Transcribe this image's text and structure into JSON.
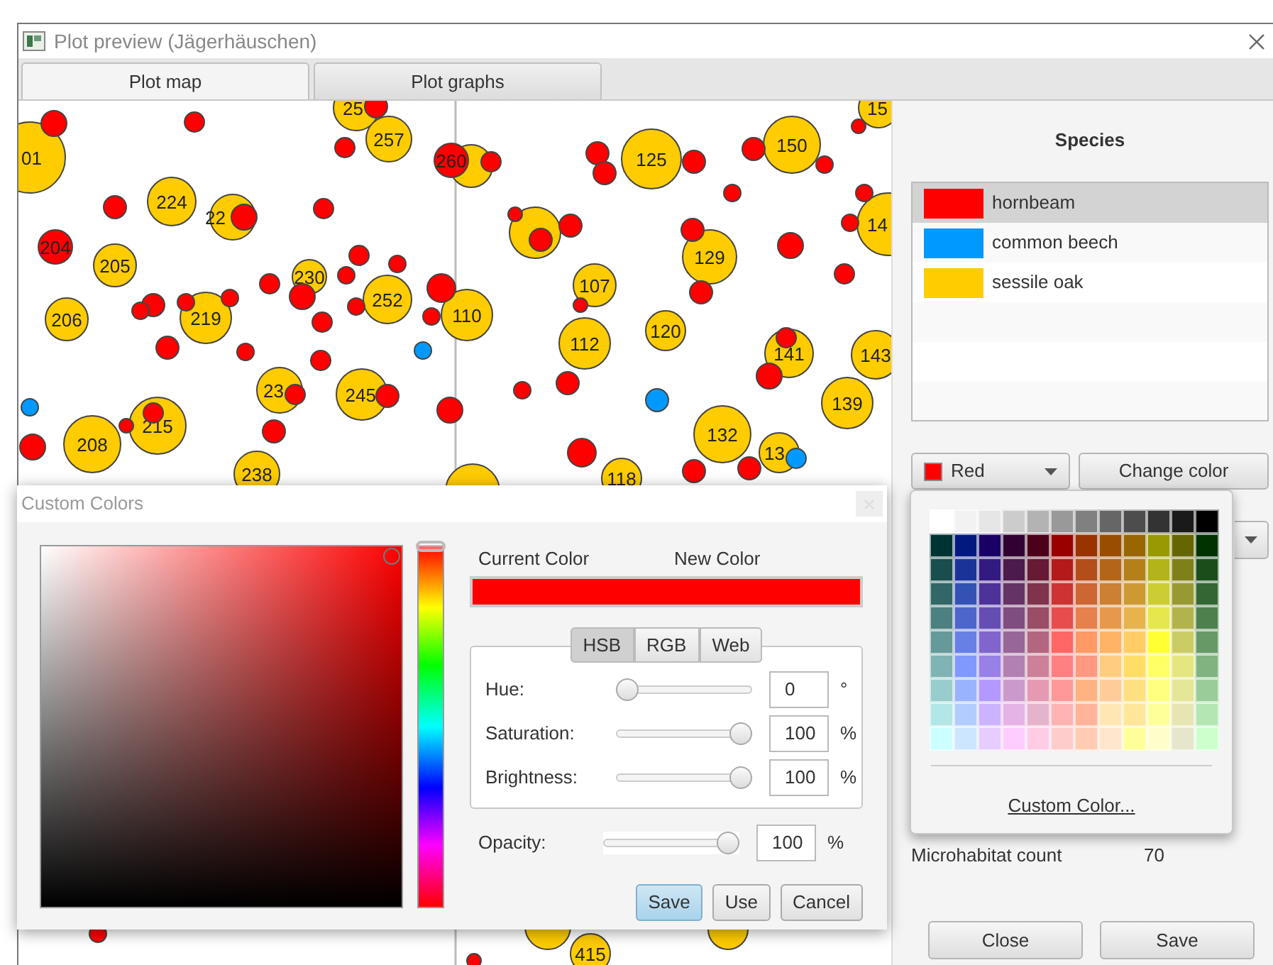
{
  "window": {
    "title": "Plot preview (Jägerhäuschen)"
  },
  "tabs": [
    {
      "label": "Plot map",
      "selected": true
    },
    {
      "label": "Plot graphs",
      "selected": false
    }
  ],
  "map": {
    "trees": [
      {
        "color": "#ffcc00",
        "label": "01"
      },
      {
        "color": "#ffcc00",
        "label": "25"
      },
      {
        "color": "#ffcc00",
        "label": "257"
      },
      {
        "color": "#ffcc00",
        "label": "224"
      },
      {
        "color": "#ffcc00",
        "label": "22"
      },
      {
        "color": "#ffcc00",
        "label": "205"
      },
      {
        "color": "#ffcc00",
        "label": "206"
      },
      {
        "color": "#ffcc00",
        "label": "219"
      },
      {
        "color": "#ffcc00",
        "label": "230"
      },
      {
        "color": "#ffcc00",
        "label": "252"
      },
      {
        "color": "#ffcc00",
        "label": "110"
      },
      {
        "color": "#ffcc00",
        "label": "23"
      },
      {
        "color": "#ffcc00",
        "label": "245"
      },
      {
        "color": "#ffcc00",
        "label": "215"
      },
      {
        "color": "#ffcc00",
        "label": "208"
      },
      {
        "color": "#ffcc00",
        "label": "238"
      },
      {
        "color": "#ffcc00"
      },
      {
        "color": "#ffcc00",
        "label": "125"
      },
      {
        "color": "#ffcc00",
        "label": "150"
      },
      {
        "color": "#ffcc00",
        "label": "15"
      },
      {
        "color": "#ffcc00",
        "label": "14"
      },
      {
        "color": "#ffcc00"
      },
      {
        "color": "#ffcc00",
        "label": "129"
      },
      {
        "color": "#ffcc00",
        "label": "107"
      },
      {
        "color": "#ffcc00",
        "label": "112"
      },
      {
        "color": "#ffcc00",
        "label": "120"
      },
      {
        "color": "#ffcc00",
        "label": "141"
      },
      {
        "color": "#ffcc00",
        "label": "143"
      },
      {
        "color": "#ffcc00",
        "label": "139"
      },
      {
        "color": "#ffcc00",
        "label": "132"
      },
      {
        "color": "#ffcc00",
        "label": "13"
      },
      {
        "color": "#ffcc00",
        "label": "118"
      },
      {
        "color": "#ffcc00"
      },
      {
        "color": "#ffcc00",
        "label": "415"
      },
      {
        "color": "#ffcc00"
      },
      {
        "color": "#ffcc00"
      },
      {
        "color": "#ff0000",
        "label": "260"
      },
      {
        "color": "#ff0000",
        "label": "204"
      },
      {
        "color": "#ff0000"
      },
      {
        "color": "#ff0000"
      },
      {
        "color": "#ff0000"
      },
      {
        "color": "#ff0000"
      },
      {
        "color": "#ff0000"
      },
      {
        "color": "#ff0000"
      },
      {
        "color": "#ff0000"
      },
      {
        "color": "#ff0000"
      },
      {
        "color": "#ff0000"
      },
      {
        "color": "#ff0000"
      },
      {
        "color": "#ff0000"
      },
      {
        "color": "#ff0000"
      },
      {
        "color": "#ff0000"
      },
      {
        "color": "#ff0000"
      },
      {
        "color": "#ff0000"
      },
      {
        "color": "#ff0000"
      },
      {
        "color": "#ff0000"
      },
      {
        "color": "#ff0000"
      },
      {
        "color": "#ff0000"
      },
      {
        "color": "#ff0000"
      },
      {
        "color": "#ff0000"
      },
      {
        "color": "#ff0000"
      },
      {
        "color": "#ff0000"
      },
      {
        "color": "#ff0000"
      },
      {
        "color": "#ff0000"
      },
      {
        "color": "#ff0000"
      },
      {
        "color": "#ff0000"
      },
      {
        "color": "#ff0000"
      },
      {
        "color": "#ff0000"
      },
      {
        "color": "#ff0000"
      },
      {
        "color": "#ff0000"
      },
      {
        "color": "#ff0000"
      },
      {
        "color": "#ff0000"
      },
      {
        "color": "#ff0000"
      },
      {
        "color": "#ff0000"
      },
      {
        "color": "#ff0000"
      },
      {
        "color": "#ff0000"
      },
      {
        "color": "#ff0000"
      },
      {
        "color": "#ff0000"
      },
      {
        "color": "#ff0000"
      },
      {
        "color": "#ff0000"
      },
      {
        "color": "#ff0000"
      },
      {
        "color": "#ff0000"
      },
      {
        "color": "#ff0000"
      },
      {
        "color": "#ff0000"
      },
      {
        "color": "#ff0000"
      },
      {
        "color": "#ff0000"
      },
      {
        "color": "#ff0000"
      },
      {
        "color": "#ff0000"
      },
      {
        "color": "#ff0000"
      },
      {
        "color": "#ff0000"
      },
      {
        "color": "#ff0000"
      },
      {
        "color": "#ff0000"
      },
      {
        "color": "#ff0000"
      },
      {
        "color": "#ff0000"
      },
      {
        "color": "#ff0000"
      },
      {
        "color": "#ff0000"
      },
      {
        "color": "#0099ff"
      },
      {
        "color": "#0099ff"
      },
      {
        "color": "#0099ff"
      },
      {
        "color": "#0099ff"
      }
    ]
  },
  "species": {
    "title": "Species",
    "items": [
      {
        "name": "hornbeam",
        "color": "#ff0000",
        "selected": true
      },
      {
        "name": "common beech",
        "color": "#0099ff",
        "selected": false
      },
      {
        "name": "sessile oak",
        "color": "#ffcc00",
        "selected": false
      }
    ]
  },
  "color_picker": {
    "value": "Red",
    "color": "#ff0000",
    "expanded": true
  },
  "change_color_button": "Change color",
  "palette": {
    "swatches": [
      {
        "color": "#ffffff"
      },
      {
        "color": "#f2f2f2"
      },
      {
        "color": "#e6e6e6"
      },
      {
        "color": "#cccccc"
      },
      {
        "color": "#b3b3b3"
      },
      {
        "color": "#999999"
      },
      {
        "color": "#808080"
      },
      {
        "color": "#666666"
      },
      {
        "color": "#4d4d4d"
      },
      {
        "color": "#333333"
      },
      {
        "color": "#1a1a1a"
      },
      {
        "color": "#000000"
      },
      {
        "color": "#003333"
      },
      {
        "color": "#001a80"
      },
      {
        "color": "#1a0066"
      },
      {
        "color": "#330033"
      },
      {
        "color": "#4d0019"
      },
      {
        "color": "#990000"
      },
      {
        "color": "#993300"
      },
      {
        "color": "#994d00"
      },
      {
        "color": "#996600"
      },
      {
        "color": "#999900"
      },
      {
        "color": "#666600"
      },
      {
        "color": "#003300"
      },
      {
        "color": "#1a4d4d"
      },
      {
        "color": "#1a3399"
      },
      {
        "color": "#331a80"
      },
      {
        "color": "#4d1a4d"
      },
      {
        "color": "#661a33"
      },
      {
        "color": "#b31a1a"
      },
      {
        "color": "#b34d1a"
      },
      {
        "color": "#b3661a"
      },
      {
        "color": "#b3801a"
      },
      {
        "color": "#b3b31a"
      },
      {
        "color": "#80801a"
      },
      {
        "color": "#1a4d1a"
      },
      {
        "color": "#336666"
      },
      {
        "color": "#3352b3"
      },
      {
        "color": "#4d3399"
      },
      {
        "color": "#663366"
      },
      {
        "color": "#80334d"
      },
      {
        "color": "#cc3333"
      },
      {
        "color": "#cc6633"
      },
      {
        "color": "#cc8033"
      },
      {
        "color": "#cc9933"
      },
      {
        "color": "#cccc33"
      },
      {
        "color": "#999933"
      },
      {
        "color": "#336633"
      },
      {
        "color": "#4d8080"
      },
      {
        "color": "#4d66cc"
      },
      {
        "color": "#664db3"
      },
      {
        "color": "#804d80"
      },
      {
        "color": "#994d66"
      },
      {
        "color": "#e64d4d"
      },
      {
        "color": "#e6804d"
      },
      {
        "color": "#e6994d"
      },
      {
        "color": "#e6b34d"
      },
      {
        "color": "#e6e64d"
      },
      {
        "color": "#b3b34d"
      },
      {
        "color": "#4d804d"
      },
      {
        "color": "#669999"
      },
      {
        "color": "#6680e6"
      },
      {
        "color": "#8066cc"
      },
      {
        "color": "#996699"
      },
      {
        "color": "#b36680"
      },
      {
        "color": "#ff6666"
      },
      {
        "color": "#ff9966"
      },
      {
        "color": "#ffb366"
      },
      {
        "color": "#ffcc66"
      },
      {
        "color": "#ffff33"
      },
      {
        "color": "#cccc66"
      },
      {
        "color": "#669966"
      },
      {
        "color": "#80b3b3"
      },
      {
        "color": "#8099ff"
      },
      {
        "color": "#9980e6"
      },
      {
        "color": "#b380b3"
      },
      {
        "color": "#cc8099"
      },
      {
        "color": "#ff8080"
      },
      {
        "color": "#ff9980"
      },
      {
        "color": "#ffcc80"
      },
      {
        "color": "#ffdd66"
      },
      {
        "color": "#ffff66"
      },
      {
        "color": "#e6e680"
      },
      {
        "color": "#80b380"
      },
      {
        "color": "#99cccc"
      },
      {
        "color": "#99b3ff"
      },
      {
        "color": "#b399ff"
      },
      {
        "color": "#cc99cc"
      },
      {
        "color": "#e699b3"
      },
      {
        "color": "#ff9999"
      },
      {
        "color": "#ffb380"
      },
      {
        "color": "#ffcc99"
      },
      {
        "color": "#ffe080"
      },
      {
        "color": "#ffff80"
      },
      {
        "color": "#e6e699"
      },
      {
        "color": "#99cc99"
      },
      {
        "color": "#b3e6e6"
      },
      {
        "color": "#b3ccff"
      },
      {
        "color": "#ccb3ff"
      },
      {
        "color": "#e6b3e6"
      },
      {
        "color": "#e6b3cc"
      },
      {
        "color": "#ffb3b3"
      },
      {
        "color": "#ffb399"
      },
      {
        "color": "#ffe6b3"
      },
      {
        "color": "#ffe699"
      },
      {
        "color": "#ffff99"
      },
      {
        "color": "#e6e6b3"
      },
      {
        "color": "#b3e6b3"
      },
      {
        "color": "#ccffff"
      },
      {
        "color": "#cce6ff"
      },
      {
        "color": "#e6ccff"
      },
      {
        "color": "#ffccff"
      },
      {
        "color": "#ffcce6"
      },
      {
        "color": "#ffcccc"
      },
      {
        "color": "#ffccb3"
      },
      {
        "color": "#ffe6cc"
      },
      {
        "color": "#ffff99"
      },
      {
        "color": "#ffffcc"
      },
      {
        "color": "#e6e6cc"
      },
      {
        "color": "#ccffcc"
      }
    ],
    "custom_link": "Custom Color..."
  },
  "microhabitat": {
    "label": "Microhabitat count",
    "value": "70"
  },
  "buttons": [
    "Close",
    "Save"
  ],
  "dialog": {
    "title": "Custom Colors",
    "current_label": "Current Color",
    "new_label": "New Color",
    "current_swatch": {
      "color": "#ff0000"
    },
    "new_swatch": {
      "color": "#ff0000"
    },
    "modes": [
      {
        "label": "HSB",
        "selected": true
      },
      {
        "label": "RGB",
        "selected": false
      },
      {
        "label": "Web",
        "selected": false
      }
    ],
    "fields": [
      {
        "label": "Hue:",
        "value": "0",
        "unit": "°",
        "level": 0
      },
      {
        "label": "Saturation:",
        "value": "100",
        "unit": "%",
        "level": 1
      },
      {
        "label": "Brightness:",
        "value": "100",
        "unit": "%",
        "level": 1
      }
    ],
    "opacity": {
      "label": "Opacity:",
      "value": "100",
      "unit": "%",
      "level": 1
    },
    "buttons": [
      {
        "label": "Save",
        "default": true
      },
      {
        "label": "Use",
        "default": false
      },
      {
        "label": "Cancel",
        "default": false
      }
    ]
  }
}
